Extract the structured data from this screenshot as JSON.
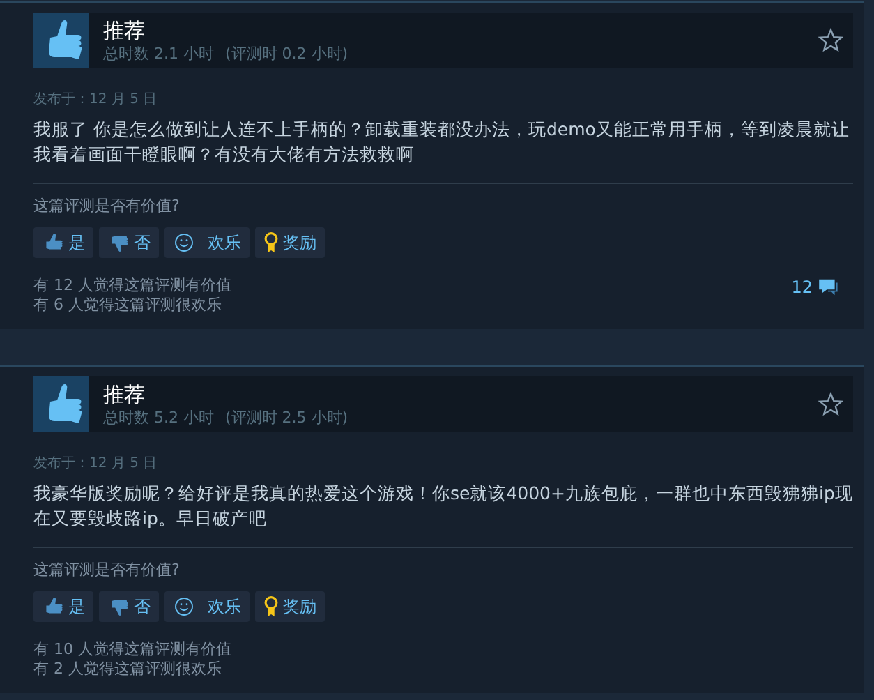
{
  "reviews": [
    {
      "verdict": "推荐",
      "recommended": true,
      "hours": "总时数 2.1 小时",
      "review_hours": "(评测时 0.2 小时)",
      "posted": "发布于：12 月 5 日",
      "body": "我服了 你是怎么做到让人连不上手柄的？卸载重装都没办法，玩demo又能正常用手柄，等到凌晨就让我看着画面干瞪眼啊？有没有大佬有方法救救啊",
      "question": "这篇评测是否有价值?",
      "buttons": [
        {
          "kind": "yes",
          "label": "是"
        },
        {
          "kind": "no",
          "label": "否"
        },
        {
          "kind": "funny",
          "label": "欢乐"
        },
        {
          "kind": "award",
          "label": "奖励"
        }
      ],
      "helpful": "有 12 人觉得这篇评测有价值",
      "funny": "有 6 人觉得这篇评测很欢乐",
      "comments": "12"
    },
    {
      "verdict": "推荐",
      "recommended": true,
      "hours": "总时数 5.2 小时",
      "review_hours": "(评测时 2.5 小时)",
      "posted": "发布于：12 月 5 日",
      "body": "我豪华版奖励呢？给好评是我真的热爱这个游戏！你se就该4000+九族包庇，一群也中东西毁狒狒ip现在又要毁歧路ip。早日破产吧",
      "question": "这篇评测是否有价值?",
      "buttons": [
        {
          "kind": "yes",
          "label": "是"
        },
        {
          "kind": "no",
          "label": "否"
        },
        {
          "kind": "funny",
          "label": "欢乐"
        },
        {
          "kind": "award",
          "label": "奖励"
        }
      ],
      "helpful": "有 10 人觉得这篇评测有价值",
      "funny": "有 2 人觉得这篇评测很欢乐"
    }
  ]
}
